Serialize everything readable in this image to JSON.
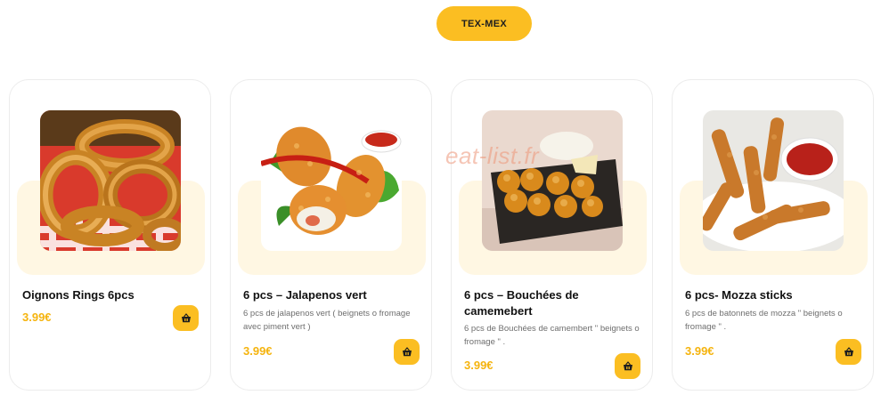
{
  "category": {
    "label": "TEX-MEX"
  },
  "watermark": "eat-list.fr",
  "products": [
    {
      "title": "Oignons Rings 6pcs",
      "description": "",
      "price": "3.99€",
      "image_icon": "onion-rings-photo"
    },
    {
      "title": "6 pcs – Jalapenos vert",
      "description": "6 pcs de jalapenos vert ( beignets o fromage avec piment vert )",
      "price": "3.99€",
      "image_icon": "jalapenos-photo"
    },
    {
      "title": "6 pcs – Bouchées de camemebert",
      "description": "6 pcs de Bouchées de camembert \" beignets o fromage \" .",
      "price": "3.99€",
      "image_icon": "camembert-bites-photo"
    },
    {
      "title": "6 pcs- Mozza sticks",
      "description": "6 pcs de batonnets de mozza \" beignets o fromage \" .",
      "price": "3.99€",
      "image_icon": "mozza-sticks-photo"
    }
  ],
  "cart_icon": "basket-icon",
  "colors": {
    "accent": "#fbbe22",
    "price": "#f5b40f",
    "card_highlight": "#fff7e3",
    "text": "#111111",
    "muted": "#6e6e6e"
  }
}
